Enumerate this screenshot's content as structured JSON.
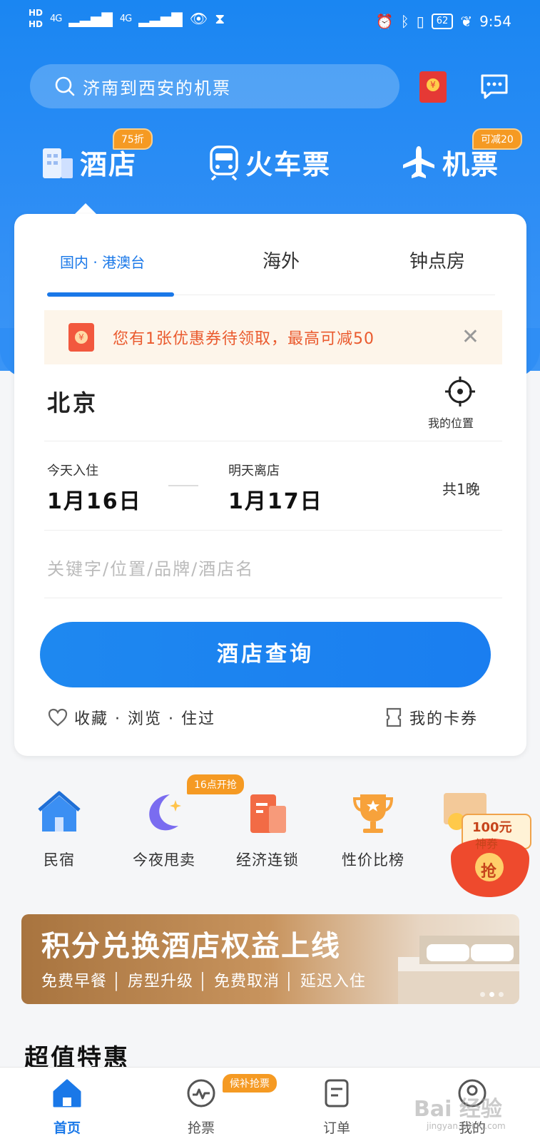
{
  "status_bar": {
    "hd1": "HD",
    "hd2": "HD",
    "signal1": "4G",
    "signal2": "4G",
    "battery": "62",
    "time": "9:54"
  },
  "header": {
    "search_placeholder": "济南到西安的机票",
    "categories": [
      {
        "label": "酒店",
        "badge": "75折"
      },
      {
        "label": "火车票"
      },
      {
        "label": "机票",
        "badge": "可减20"
      }
    ]
  },
  "card": {
    "tabs": [
      {
        "label": "国内 · 港澳台",
        "active": true
      },
      {
        "label": "海外"
      },
      {
        "label": "钟点房"
      }
    ],
    "coupon_text": "您有1张优惠券待领取，最高可减50",
    "city": "北京",
    "locate_label": "我的位置",
    "checkin_label": "今天入住",
    "checkin_date": "1月16日",
    "checkout_label": "明天离店",
    "checkout_date": "1月17日",
    "nights": "共1晚",
    "keyword_placeholder": "关键字/位置/品牌/酒店名",
    "query_button": "酒店查询",
    "history_links": "收藏 · 浏览 · 住过",
    "my_cards": "我的卡券"
  },
  "quick_entries": [
    {
      "label": "民宿",
      "icon": "house-icon"
    },
    {
      "label": "今夜甩卖",
      "icon": "moon-icon",
      "badge": "16点开抢"
    },
    {
      "label": "经济连锁",
      "icon": "building-icon"
    },
    {
      "label": "性价比榜",
      "icon": "trophy-icon"
    }
  ],
  "promo_float": {
    "amount": "100元",
    "label": "神券",
    "action": "抢"
  },
  "banner": {
    "title": "积分兑换酒店权益上线",
    "subtitle": "免费早餐 │ 房型升级 │ 免费取消 │ 延迟入住"
  },
  "section_title": "超值特惠",
  "bottom_nav": [
    {
      "label": "首页",
      "active": true
    },
    {
      "label": "抢票",
      "badge": "候补抢票"
    },
    {
      "label": "订单"
    },
    {
      "label": "我的"
    }
  ],
  "watermark": {
    "text": "Bai 经验",
    "sub": "jingyan.baidu.com"
  },
  "colors": {
    "primary": "#1a78e8",
    "accent_orange": "#f59a23",
    "coupon_red": "#ea5a2e"
  }
}
